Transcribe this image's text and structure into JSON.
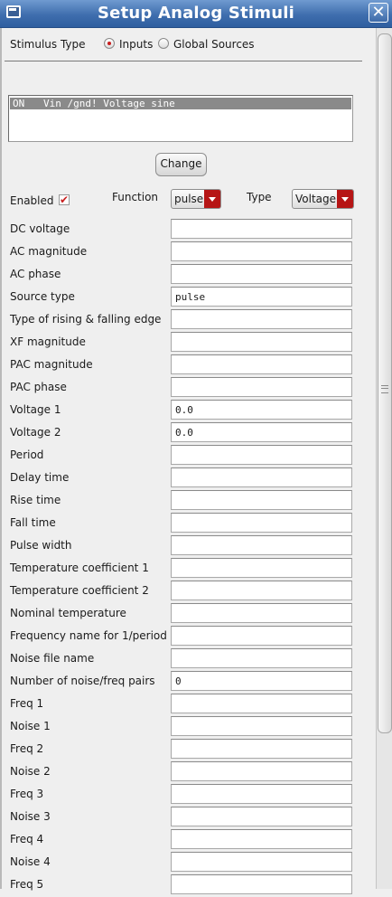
{
  "window": {
    "title": "Setup Analog Stimuli",
    "close_glyph": "✕"
  },
  "stimulus_type": {
    "label": "Stimulus Type",
    "options": [
      {
        "label": "Inputs",
        "selected": true
      },
      {
        "label": "Global Sources",
        "selected": false
      }
    ]
  },
  "stimuli_list": [
    {
      "state": "ON",
      "description": "Vin /gnd! Voltage sine"
    }
  ],
  "change_button": "Change",
  "controls": {
    "enabled_label": "Enabled",
    "enabled_checked": true,
    "check_glyph": "✔",
    "function_label": "Function",
    "function_value": "pulse",
    "type_label": "Type",
    "type_value": "Voltage"
  },
  "fields": [
    {
      "label": "DC voltage",
      "value": ""
    },
    {
      "label": "AC magnitude",
      "value": ""
    },
    {
      "label": "AC phase",
      "value": ""
    },
    {
      "label": "Source type",
      "value": "pulse"
    },
    {
      "label": "Type of rising & falling edge",
      "value": ""
    },
    {
      "label": "XF magnitude",
      "value": ""
    },
    {
      "label": "PAC magnitude",
      "value": ""
    },
    {
      "label": "PAC phase",
      "value": ""
    },
    {
      "label": "Voltage 1",
      "value": "0.0"
    },
    {
      "label": "Voltage 2",
      "value": "0.0"
    },
    {
      "label": "Period",
      "value": ""
    },
    {
      "label": "Delay time",
      "value": ""
    },
    {
      "label": "Rise time",
      "value": ""
    },
    {
      "label": "Fall time",
      "value": ""
    },
    {
      "label": "Pulse width",
      "value": ""
    },
    {
      "label": "Temperature coefficient 1",
      "value": ""
    },
    {
      "label": "Temperature coefficient 2",
      "value": ""
    },
    {
      "label": "Nominal temperature",
      "value": ""
    },
    {
      "label": "Frequency name for 1/period",
      "value": ""
    },
    {
      "label": "Noise file name",
      "value": ""
    },
    {
      "label": "Number of noise/freq pairs",
      "value": "0"
    },
    {
      "label": "Freq 1",
      "value": ""
    },
    {
      "label": "Noise 1",
      "value": ""
    },
    {
      "label": "Freq 2",
      "value": ""
    },
    {
      "label": "Noise 2",
      "value": ""
    },
    {
      "label": "Freq 3",
      "value": ""
    },
    {
      "label": "Noise 3",
      "value": ""
    },
    {
      "label": "Freq 4",
      "value": ""
    },
    {
      "label": "Noise 4",
      "value": ""
    },
    {
      "label": "Freq 5",
      "value": ""
    }
  ],
  "icons": {
    "window_icon": "window-icon",
    "close": "close-icon",
    "dropdown": "chevron-down-icon"
  }
}
